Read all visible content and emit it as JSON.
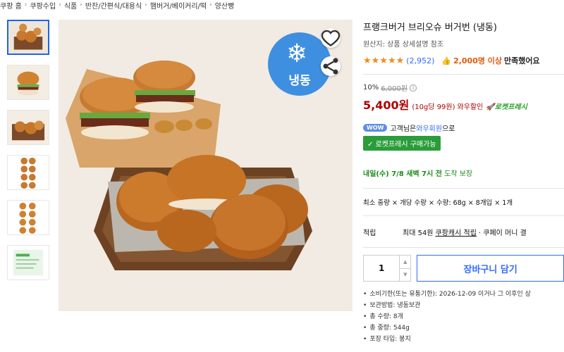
{
  "breadcrumb": [
    "쿠팡 홈",
    "쿠팡수입",
    "식품",
    "반찬/간편식/대용식",
    "햄버거/베이커리/떡",
    "양산빵"
  ],
  "product": {
    "title": "프랭크버거 브리오슈 버거번 (냉동)",
    "origin": "원산지: 상품 상세설명 참조",
    "stars": "★★★★★",
    "review_count": "(2,952)",
    "satisfaction_count": "2,000명 이상",
    "satisfaction_suffix": "만족했어요",
    "discount_rate": "10%",
    "original_price": "6,000원",
    "sale_price": "5,400원",
    "unit_price": "(10g당 99원)",
    "wow_discount": "와우할인",
    "rocket_fresh": "로켓프레시",
    "wow_badge": "WOW",
    "wow_prefix": "고객님은",
    "wow_member": "와우회원",
    "wow_suffix": "으로",
    "fresh_available": "✓ 로켓프레시 구매가능",
    "delivery_date": "내일(수) 7/8 새벽 7시 전",
    "delivery_suffix": "도착 보장",
    "quantity_info": "최소 중량 × 개당 수량 × 수량: 68g × 8개입 × 1개",
    "points_label": "적립",
    "points_value": "최대 54원",
    "points_link": "쿠팡캐시 적립",
    "points_extra": "· 쿠페이 머니 결",
    "quantity": "1",
    "cart_button": "장바구니 담기",
    "frozen_label": "냉동",
    "details": [
      "소비기한(또는 유통기한): 2026-12-09 이거나 그 이후인 상",
      "보관방법: 냉동보관",
      "총 수량: 8개",
      "총 중량: 544g",
      "포장 타입: 봉지"
    ]
  },
  "colors": {
    "price_red": "#ae0000",
    "link_blue": "#346aff",
    "fresh_green": "#2a9d3a",
    "star_orange": "#f08c1a",
    "frozen_blue": "#3f8fe0"
  }
}
